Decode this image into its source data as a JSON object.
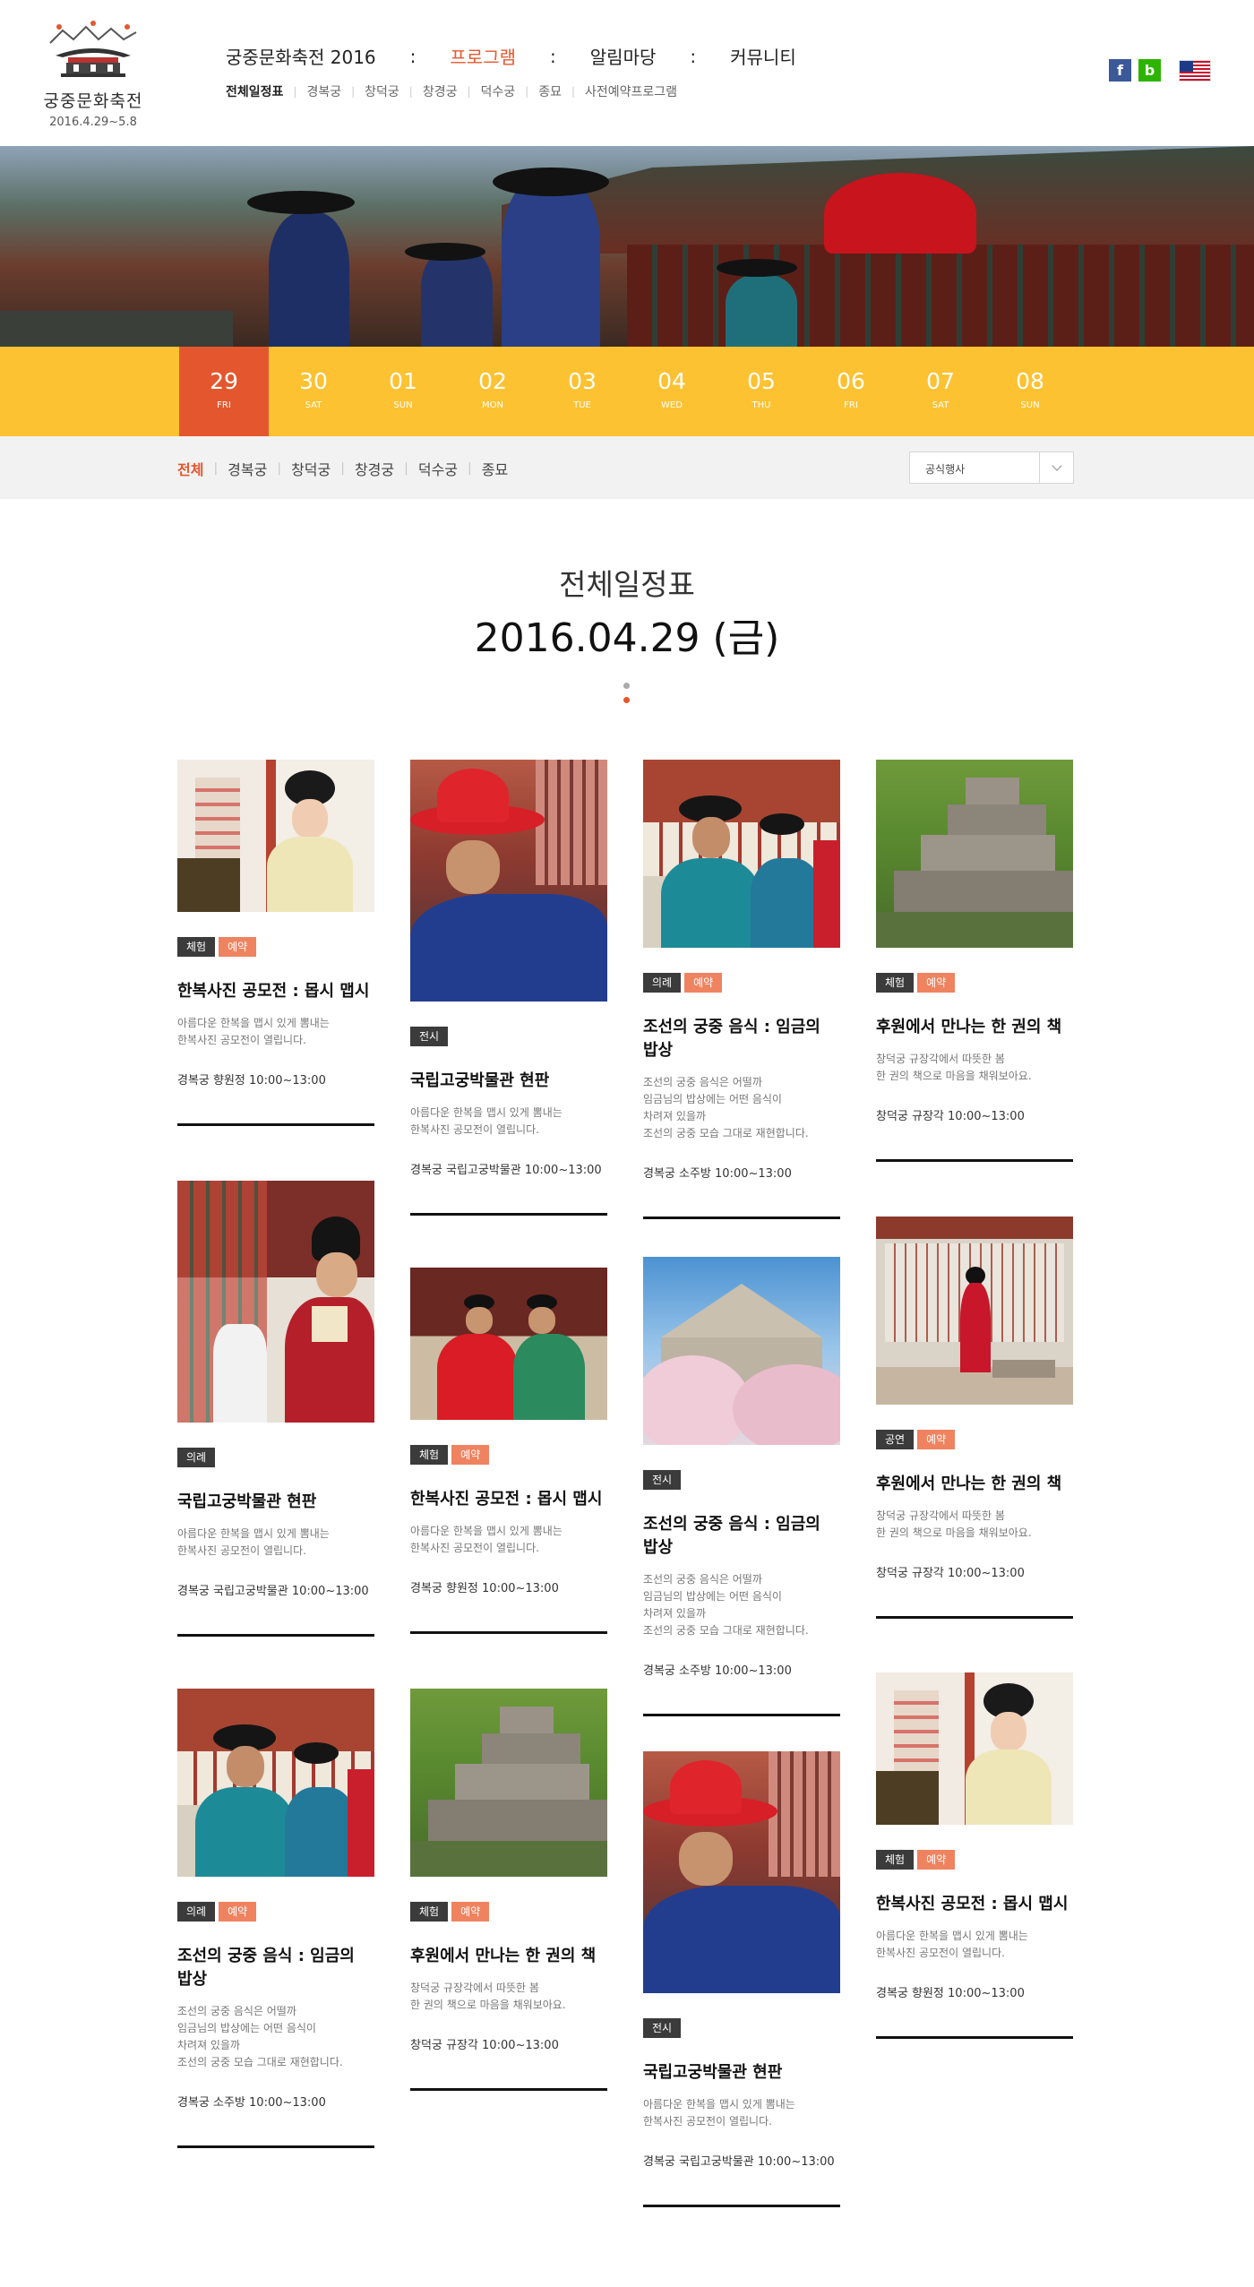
{
  "logo": {
    "title": "궁중문화축전",
    "date": "2016.4.29~5.8"
  },
  "gnb": [
    {
      "label": "궁중문화축전 2016",
      "active": false
    },
    {
      "label": "프로그램",
      "active": true
    },
    {
      "label": "알림마당",
      "active": false
    },
    {
      "label": "커뮤니티",
      "active": false
    }
  ],
  "gnb_separator": ":",
  "lnb": [
    {
      "label": "전체일정표",
      "active": true
    },
    {
      "label": "경복궁",
      "active": false
    },
    {
      "label": "창덕궁",
      "active": false
    },
    {
      "label": "창경궁",
      "active": false
    },
    {
      "label": "덕수궁",
      "active": false
    },
    {
      "label": "종묘",
      "active": false
    },
    {
      "label": "사전예약프로그램",
      "active": false
    }
  ],
  "util": {
    "facebook_glyph": "f",
    "blog_glyph": "b"
  },
  "dates": [
    {
      "num": "29",
      "dow": "FRI",
      "active": true
    },
    {
      "num": "30",
      "dow": "SAT",
      "active": false
    },
    {
      "num": "01",
      "dow": "SUN",
      "active": false
    },
    {
      "num": "02",
      "dow": "MON",
      "active": false
    },
    {
      "num": "03",
      "dow": "TUE",
      "active": false
    },
    {
      "num": "04",
      "dow": "WED",
      "active": false
    },
    {
      "num": "05",
      "dow": "THU",
      "active": false
    },
    {
      "num": "06",
      "dow": "FRI",
      "active": false
    },
    {
      "num": "07",
      "dow": "SAT",
      "active": false
    },
    {
      "num": "08",
      "dow": "SUN",
      "active": false
    }
  ],
  "filter": {
    "palaces": [
      {
        "label": "전체",
        "active": true
      },
      {
        "label": "경복궁",
        "active": false
      },
      {
        "label": "창덕궁",
        "active": false
      },
      {
        "label": "창경궁",
        "active": false
      },
      {
        "label": "덕수궁",
        "active": false
      },
      {
        "label": "종묘",
        "active": false
      }
    ],
    "select_value": "공식행사"
  },
  "heading": {
    "title": "전체일정표",
    "date": "2016.04.29 (금)"
  },
  "colors": {
    "accent": "#e4572e",
    "datebar": "#fcc232",
    "tag_dark": "#3b3b3b",
    "tag_orange": "#ef8360"
  },
  "cards": [
    {
      "image": "hanbok-woman",
      "tags": [
        "체험",
        "예약"
      ],
      "title": "한복사진 공모전 : 몹시 맵시",
      "desc": "아름다운 한복을 맵시 있게 뽐내는\n한복사진 공모전이 열립니다.",
      "meta": "경복궁 향원정  10:00~13:00"
    },
    {
      "image": "red-hat-guard",
      "tags": [
        "전시"
      ],
      "title": "국립고궁박물관 현판",
      "desc": "아름다운 한복을 맵시 있게 뽐내는\n한복사진 공모전이 열립니다.",
      "meta": "경복궁 국립고궁박물관  10:00~13:00"
    },
    {
      "image": "officials-teal",
      "tags": [
        "의례",
        "예약"
      ],
      "title": "조선의 궁중 음식 : 임금의 밥상",
      "desc": "조선의 궁중 음식은 어떨까\n임금님의 밥상에는 어떤 음식이\n차려져 있을까\n조선의 궁중 모습 그대로 재현합니다.",
      "meta": "경복궁 소주방  10:00~13:00"
    },
    {
      "image": "stone-steps",
      "tags": [
        "체험",
        "예약"
      ],
      "title": "후원에서 만나는 한 권의 책",
      "desc": "창덕궁 규장각에서 따뜻한 봄\n한 권의 책으로 마음을 채워보아요.",
      "meta": "창덕궁 규장각  10:00~13:00"
    },
    {
      "image": "official-portrait",
      "tags": [
        "의례"
      ],
      "title": "국립고궁박물관 현판",
      "desc": "아름다운 한복을 맵시 있게 뽐내는\n한복사진 공모전이 열립니다.",
      "meta": "경복궁 국립고궁박물관  10:00~13:00"
    },
    {
      "image": "royal-procession",
      "tags": [
        "체험",
        "예약"
      ],
      "title": "한복사진 공모전 : 몹시 맵시",
      "desc": "아름다운 한복을 맵시 있게 뽐내는\n한복사진 공모전이 열립니다.",
      "meta": "경복궁 향원정  10:00~13:00"
    },
    {
      "image": "cherry-blossom",
      "tags": [
        "전시"
      ],
      "title": "조선의 궁중 음식 : 임금의 밥상",
      "desc": "조선의 궁중 음식은 어떨까\n임금님의 밥상에는 어떤 음식이\n차려져 있을까\n조선의 궁중 모습 그대로 재현합니다.",
      "meta": "경복궁 소주방  10:00~13:00"
    },
    {
      "image": "palace-interior",
      "tags": [
        "공연",
        "예약"
      ],
      "title": "후원에서 만나는 한 권의 책",
      "desc": "창덕궁 규장각에서 따뜻한 봄\n한 권의 책으로 마음을 채워보아요.",
      "meta": "창덕궁 규장각  10:00~13:00"
    },
    {
      "image": "officials-teal",
      "tags": [
        "의례",
        "예약"
      ],
      "title": "조선의 궁중 음식 : 임금의 밥상",
      "desc": "조선의 궁중 음식은 어떨까\n임금님의 밥상에는 어떤 음식이\n차려져 있을까\n조선의 궁중 모습 그대로 재현합니다.",
      "meta": "경복궁 소주방  10:00~13:00"
    },
    {
      "image": "stone-steps",
      "tags": [
        "체험",
        "예약"
      ],
      "title": "후원에서 만나는 한 권의 책",
      "desc": "창덕궁 규장각에서 따뜻한 봄\n한 권의 책으로 마음을 채워보아요.",
      "meta": "창덕궁 규장각  10:00~13:00"
    },
    {
      "image": "red-hat-guard",
      "tags": [
        "전시"
      ],
      "title": "국립고궁박물관 현판",
      "desc": "아름다운 한복을 맵시 있게 뽐내는\n한복사진 공모전이 열립니다.",
      "meta": "경복궁 국립고궁박물관  10:00~13:00"
    },
    {
      "image": "hanbok-woman",
      "tags": [
        "체험",
        "예약"
      ],
      "title": "한복사진 공모전 : 몹시 맵시",
      "desc": "아름다운 한복을 맵시 있게 뽐내는\n한복사진 공모전이 열립니다.",
      "meta": "경복궁 향원정  10:00~13:00"
    }
  ]
}
